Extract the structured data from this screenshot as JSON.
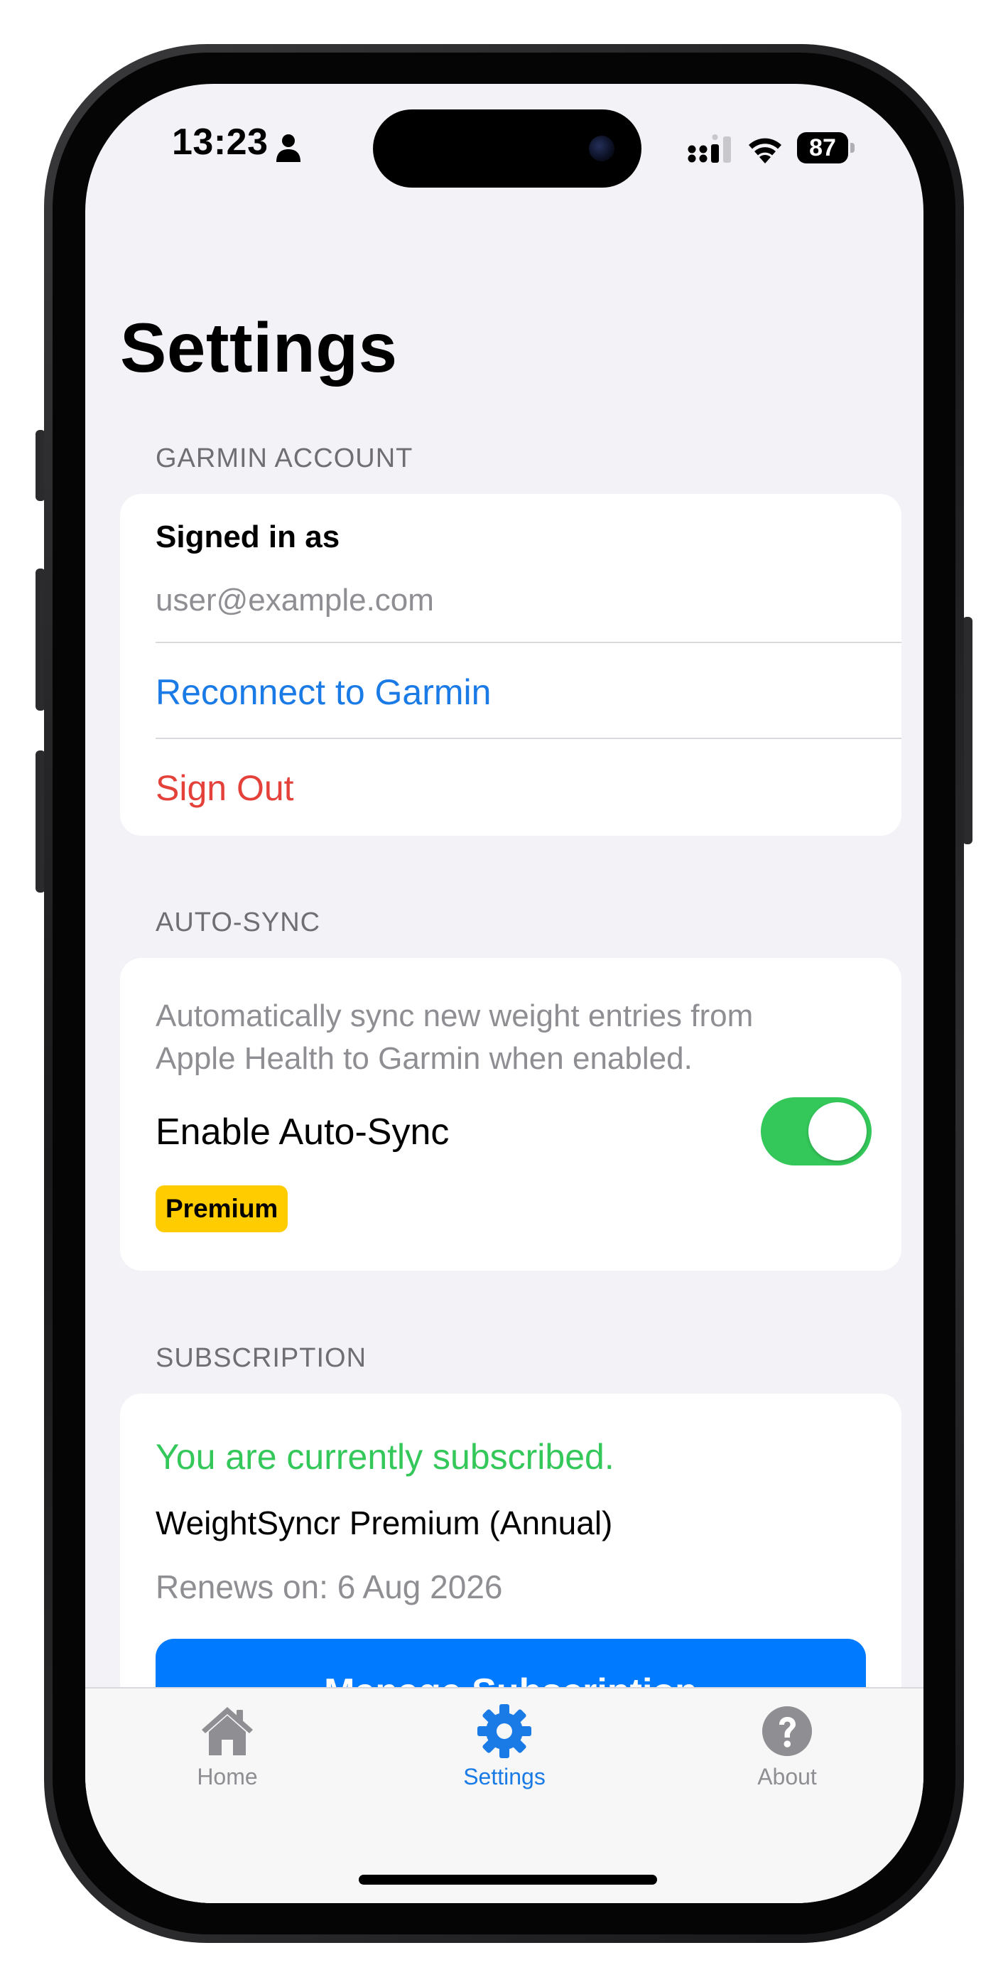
{
  "status_bar": {
    "time": "13:23",
    "battery_level": "87"
  },
  "page": {
    "title": "Settings"
  },
  "garmin_account": {
    "header": "GARMIN ACCOUNT",
    "signed_in_label": "Signed in as",
    "email": "user@example.com",
    "reconnect_label": "Reconnect to Garmin",
    "sign_out_label": "Sign Out"
  },
  "auto_sync": {
    "header": "AUTO-SYNC",
    "description": "Automatically sync new weight entries from Apple Health to Garmin when enabled.",
    "toggle_label": "Enable Auto-Sync",
    "enabled": true,
    "badge": "Premium"
  },
  "subscription": {
    "header": "SUBSCRIPTION",
    "status": "You are currently subscribed.",
    "plan": "WeightSyncr Premium (Annual)",
    "renews": "Renews on: 6 Aug 2026",
    "manage_label": "Manage Subscription"
  },
  "tab_bar": {
    "tabs": [
      {
        "label": "Home",
        "icon": "house-icon",
        "selected": false
      },
      {
        "label": "Settings",
        "icon": "gear-icon",
        "selected": true
      },
      {
        "label": "About",
        "icon": "question-circle-icon",
        "selected": false
      }
    ]
  },
  "colors": {
    "accent": "#007aff",
    "link": "#1a7ae6",
    "destructive": "#e5413b",
    "success": "#34c759",
    "badge": "#ffcc00",
    "background": "#f2f2f7"
  }
}
